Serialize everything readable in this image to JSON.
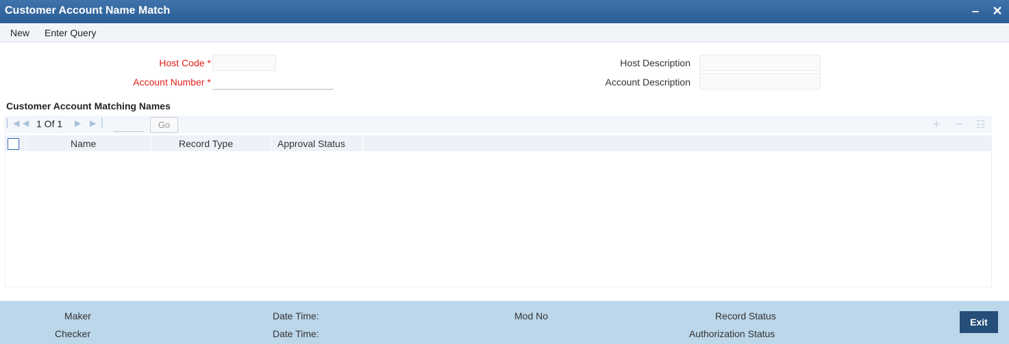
{
  "window": {
    "title": "Customer Account Name Match",
    "minimize_glyph": "–",
    "close_glyph": "✕"
  },
  "menu": {
    "new_label": "New",
    "enter_query_label": "Enter Query"
  },
  "form": {
    "host_code_label": "Host Code",
    "host_code_value": "",
    "account_number_label": "Account Number",
    "account_number_value": "",
    "host_description_label": "Host Description",
    "host_description_value": "",
    "account_description_label": "Account Description",
    "account_description_value": "",
    "required_marker": "*"
  },
  "grid": {
    "section_title": "Customer Account Matching Names",
    "pager": {
      "page_text": "1 Of 1",
      "go_label": "Go",
      "page_input_value": ""
    },
    "columns": [
      "Name",
      "Record Type",
      "Approval Status"
    ],
    "rows": []
  },
  "footer": {
    "maker_label": "Maker",
    "checker_label": "Checker",
    "date_time_label_1": "Date Time:",
    "date_time_label_2": "Date Time:",
    "mod_no_label": "Mod No",
    "record_status_label": "Record Status",
    "authorization_status_label": "Authorization Status",
    "exit_label": "Exit"
  },
  "colors": {
    "title_bar": "#2f6097",
    "required_label": "#e0201b",
    "footer_bg": "#bcd6ea",
    "exit_button": "#254e78"
  }
}
